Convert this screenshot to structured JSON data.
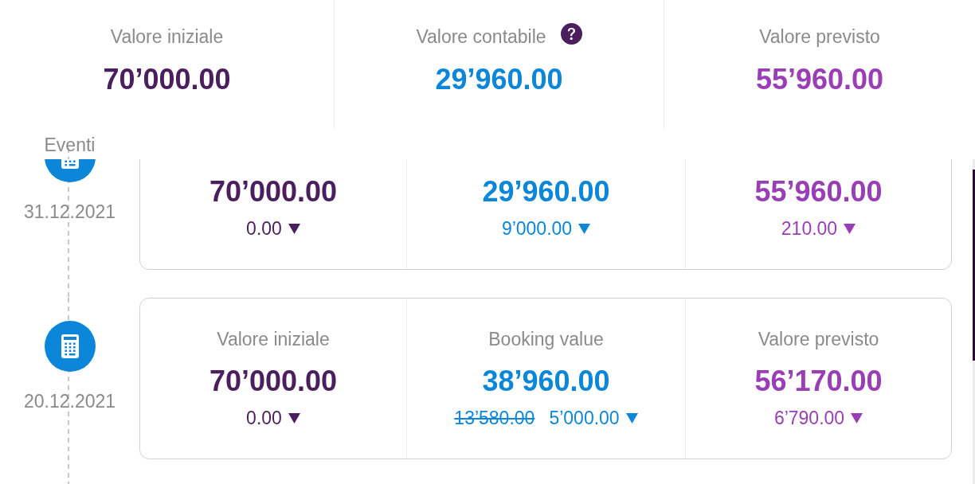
{
  "summary": [
    {
      "label": "Valore iniziale",
      "value": "70’000.00",
      "color": "#4b1e5e",
      "help": false
    },
    {
      "label": "Valore contabile",
      "value": "29’960.00",
      "color": "#0b86d8",
      "help": true
    },
    {
      "label": "Valore previsto",
      "value": "55’960.00",
      "color": "#9a3eb6",
      "help": false
    }
  ],
  "events_label": "Eventi",
  "events": [
    {
      "date": "31.12.2021",
      "metrics": [
        {
          "value": "70’000.00",
          "change": "0.00",
          "color": "#4b1e5e"
        },
        {
          "value": "29’960.00",
          "change": "9’000.00",
          "color": "#0b86d8"
        },
        {
          "value": "55’960.00",
          "change": "210.00",
          "color": "#9a3eb6"
        }
      ]
    },
    {
      "date": "20.12.2021",
      "metrics": [
        {
          "label": "Valore iniziale",
          "value": "70’000.00",
          "change": "0.00",
          "color": "#4b1e5e"
        },
        {
          "label": "Booking value",
          "value": "38’960.00",
          "previous": "13’580.00",
          "change": "5’000.00",
          "color": "#0b86d8"
        },
        {
          "label": "Valore previsto",
          "value": "56’170.00",
          "change": "6’790.00",
          "color": "#9a3eb6"
        }
      ]
    }
  ]
}
